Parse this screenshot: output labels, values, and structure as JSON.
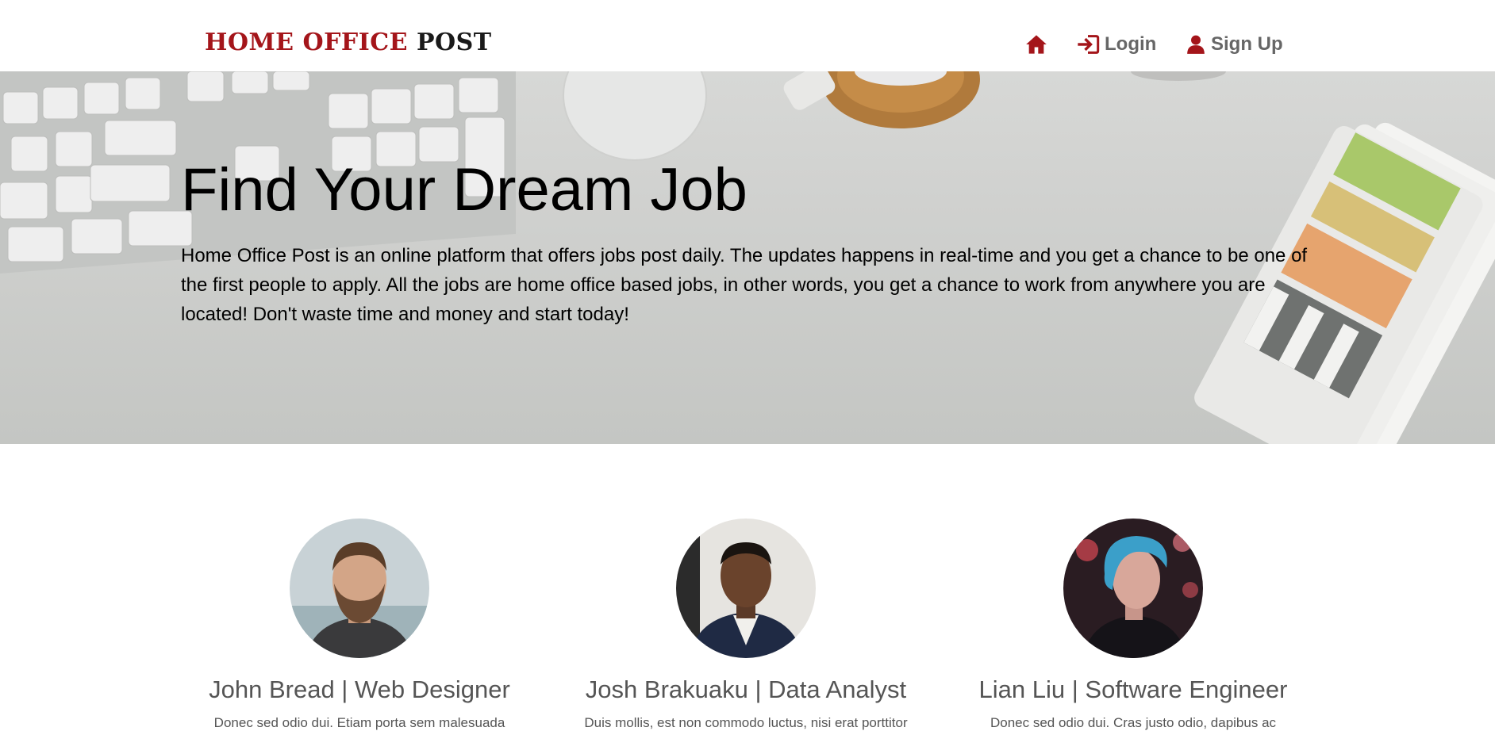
{
  "navbar": {
    "brand_part1": "HOME OFFICE ",
    "brand_part2": "POST",
    "home_icon": "home-icon",
    "login_label": "Login",
    "login_icon": "login-icon",
    "signup_label": "Sign Up",
    "signup_icon": "user-icon"
  },
  "hero": {
    "title": "Find Your Dream Job",
    "text": "Home Office Post is an online platform that offers jobs post daily. The updates happens in real-time and you get a chance to be one of the first people to apply. All the jobs are home office based jobs, in other words, you get a chance to work from anywhere you are located! Don't waste time and money and start today!"
  },
  "team": [
    {
      "name": "John Bread | Web Designer",
      "description": "Donec sed odio dui. Etiam porta sem malesuada"
    },
    {
      "name": "Josh Brakuaku | Data Analyst",
      "description": "Duis mollis, est non commodo luctus, nisi erat porttitor"
    },
    {
      "name": "Lian Liu | Software Engineer",
      "description": "Donec sed odio dui. Cras justo odio, dapibus ac"
    }
  ],
  "colors": {
    "brand_red": "#a4151a",
    "nav_text": "#666666",
    "name_text": "#555555"
  }
}
